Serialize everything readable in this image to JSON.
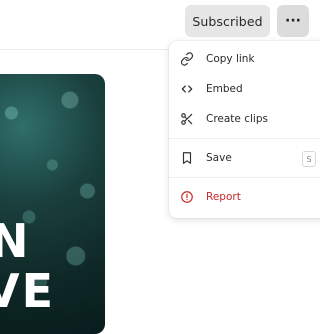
{
  "header": {
    "subscribed_label": "Subscribed",
    "more_label": "···"
  },
  "thumbnail": {
    "line1": "N",
    "line2": "VE"
  },
  "menu": {
    "items": [
      {
        "label": "Copy link",
        "icon": "link-icon"
      },
      {
        "label": "Embed",
        "icon": "code-icon"
      },
      {
        "label": "Create clips",
        "icon": "scissors-icon"
      },
      {
        "label": "Save",
        "icon": "bookmark-icon",
        "shortcut": "S"
      },
      {
        "label": "Report",
        "icon": "alert-circle-icon"
      }
    ]
  },
  "colors": {
    "report_red": "#c62828",
    "button_gray": "#e6e6e6"
  }
}
